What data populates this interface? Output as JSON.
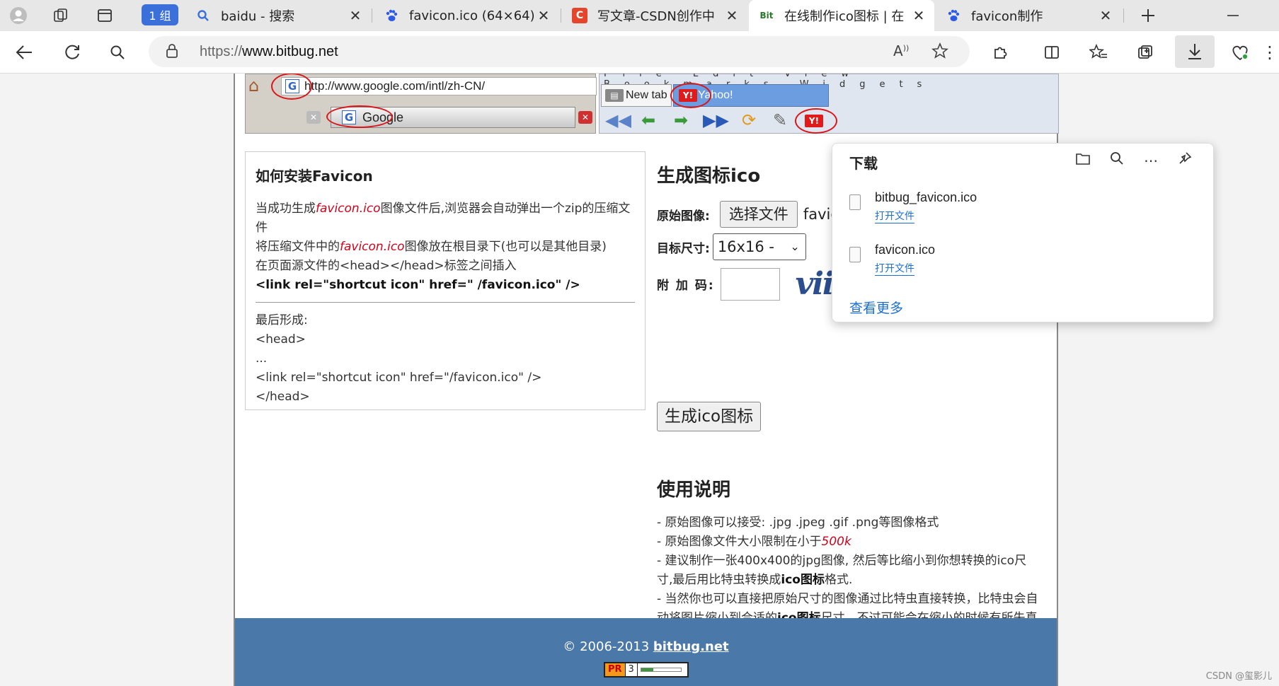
{
  "browser": {
    "group_label": "1 组",
    "tabs": [
      {
        "title": "baidu - 搜索",
        "icon": "search-icon"
      },
      {
        "title": "favicon.ico (64×64)",
        "icon": "baidu-paw-icon"
      },
      {
        "title": "写文章-CSDN创作中",
        "icon": "csdn-c-icon"
      },
      {
        "title": "在线制作ico图标 | 在",
        "icon": "bitbug-icon"
      },
      {
        "title": "favicon制作",
        "icon": "baidu-paw-icon"
      }
    ],
    "url_protocol": "https://",
    "url_host": "www.bitbug.net",
    "colors": {
      "group": "#3b6fd9",
      "footer": "#4a78a8",
      "link": "#1a6fd1",
      "emphasis": "#d0021b"
    }
  },
  "banner": {
    "google_url": "http://www.google.com/intl/zh-CN/",
    "google_tab": "Google",
    "new_tab": "New tab",
    "yahoo_tab": "Yahoo!",
    "menu": "File Edit View Bookmarks Widgets"
  },
  "install": {
    "title": "如何安装Favicon",
    "line1_pre": "当成功生成",
    "line1_em": "favicon.ico",
    "line1_post": "图像文件后,浏览器会自动弹出一个zip的压缩文件",
    "line2_pre": "将压缩文件中的",
    "line2_em": "favicon.ico",
    "line2_post": "图像放在根目录下(也可以是其他目录)",
    "line3": "在页面源文件的<head></head>标签之间插入",
    "code": "<link rel=\"shortcut icon\" href=\" /favicon.ico\" />",
    "final_label": "最后形成:",
    "final1": "<head>",
    "final2": "...",
    "final3": "<link rel=\"shortcut icon\" href=\"/favicon.ico\" />",
    "final4": "</head>"
  },
  "form": {
    "title": "生成图标ico",
    "source_label": "原始图像:",
    "choose_file": "选择文件",
    "file_name": "favic",
    "size_label": "目标尺寸:",
    "size_value": "16x16 -",
    "code_label": "附 加 码:",
    "captcha": "viie",
    "generate": "生成ico图标"
  },
  "usage": {
    "title": "使用说明",
    "l1": "- 原始图像可以接受: .jpg .jpeg .gif .png等图像格式",
    "l2_pre": "- 原始图像文件大小限制在小于",
    "l2_em": "500k",
    "l3_pre": "- 建议制作一张400x400的jpg图像, 然后等比缩小到你想转换的ico尺寸,最后用比特虫转换成",
    "l3_b": "ico图标",
    "l3_post": "格式.",
    "l4_pre": "- 当然你也可以直接把原始尺寸的图像通过比特虫直接转换，比特虫会自动将图片缩小到合适的",
    "l4_b": "ico图标",
    "l4_post": "尺寸，不过可能会在缩小的时候有所失真"
  },
  "footer": {
    "copy_pre": "© 2006-2013 ",
    "site": "bitbug.net",
    "pr_label": "PR",
    "pr_value": "3",
    "pr_fraction": 0.3
  },
  "downloads": {
    "title": "下载",
    "items": [
      {
        "name": "bitbug_favicon.ico",
        "action": "打开文件"
      },
      {
        "name": "favicon.ico",
        "action": "打开文件"
      }
    ],
    "more": "查看更多"
  },
  "watermark": "CSDN @玺影儿"
}
